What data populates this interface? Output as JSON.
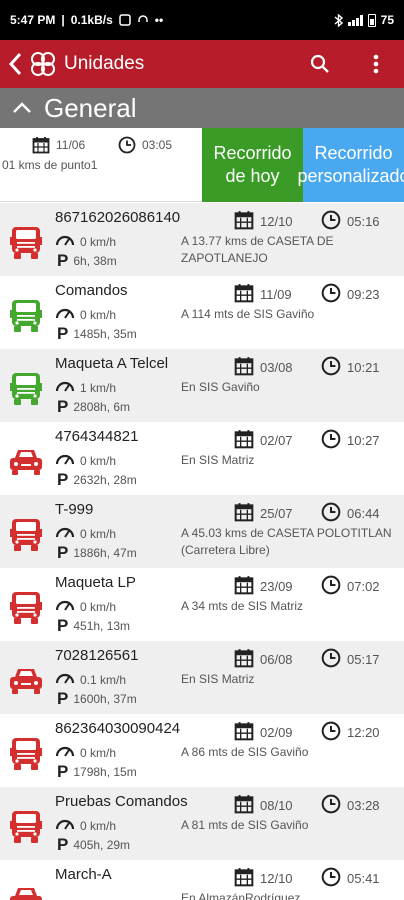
{
  "status_bar": {
    "time": "5:47 PM",
    "speed": "0.1kB/s",
    "extra": "••",
    "battery": "75"
  },
  "app_bar": {
    "title": "Unidades",
    "back_icon": "back-chevron-icon",
    "search_icon": "search-icon",
    "menu_icon": "more-vertical-icon",
    "color": "#b71c2a"
  },
  "group": {
    "label": "General",
    "icon": "chevron-up-icon",
    "color": "#757575"
  },
  "summary": {
    "date": "11/06",
    "time": "03:05",
    "distance": "01 kms de punto1",
    "today_button": "Recorrido de hoy",
    "custom_button": "Recorrido personalizado",
    "today_color": "#3a9c26",
    "custom_color": "#4aa8f0"
  },
  "units": [
    {
      "name": "867162026086140",
      "speed": "0 km/h",
      "parked": "6h, 38m",
      "date": "12/10",
      "time": "05:16",
      "location": "A 13.77 kms de CASETA DE ZAPOTLANEJO",
      "vehicle": "truck",
      "color": "#d32f2f"
    },
    {
      "name": "Comandos",
      "speed": "0 km/h",
      "parked": "1485h, 35m",
      "date": "11/09",
      "time": "09:23",
      "location": "A 114 mts de SIS Gaviño",
      "vehicle": "truck",
      "color": "#43a82d"
    },
    {
      "name": "Maqueta A Telcel",
      "speed": "1 km/h",
      "parked": "2808h, 6m",
      "date": "03/08",
      "time": "10:21",
      "location": "En SIS Gaviño",
      "vehicle": "truck",
      "color": "#43a82d"
    },
    {
      "name": "4764344821",
      "speed": "0 km/h",
      "parked": "2632h, 28m",
      "date": "02/07",
      "time": "10:27",
      "location": "En SIS Matriz",
      "vehicle": "car",
      "color": "#d32f2f"
    },
    {
      "name": "T-999",
      "speed": "0 km/h",
      "parked": "1886h, 47m",
      "date": "25/07",
      "time": "06:44",
      "location": "A 45.03 kms de CASETA POLOTITLAN  (Carretera Libre)",
      "vehicle": "truck",
      "color": "#d32f2f"
    },
    {
      "name": "Maqueta LP",
      "speed": "0 km/h",
      "parked": "451h, 13m",
      "date": "23/09",
      "time": "07:02",
      "location": "A 34 mts de SIS Matriz",
      "vehicle": "truck",
      "color": "#d32f2f"
    },
    {
      "name": "7028126561",
      "speed": "0.1 km/h",
      "parked": "1600h, 37m",
      "date": "06/08",
      "time": "05:17",
      "location": "En SIS Matriz",
      "vehicle": "car",
      "color": "#d32f2f"
    },
    {
      "name": "862364030090424",
      "speed": "0 km/h",
      "parked": "1798h, 15m",
      "date": "02/09",
      "time": "12:20",
      "location": "A 86 mts de SIS Gaviño",
      "vehicle": "truck",
      "color": "#d32f2f"
    },
    {
      "name": "Pruebas Comandos",
      "speed": "0 km/h",
      "parked": "405h, 29m",
      "date": "08/10",
      "time": "03:28",
      "location": "A 81 mts de SIS Gaviño",
      "vehicle": "truck",
      "color": "#d32f2f"
    },
    {
      "name": "March-A",
      "speed": "",
      "parked": "",
      "date": "12/10",
      "time": "05:41",
      "location": "En AlmazánRodríguez",
      "vehicle": "car",
      "color": "#d32f2f"
    }
  ]
}
